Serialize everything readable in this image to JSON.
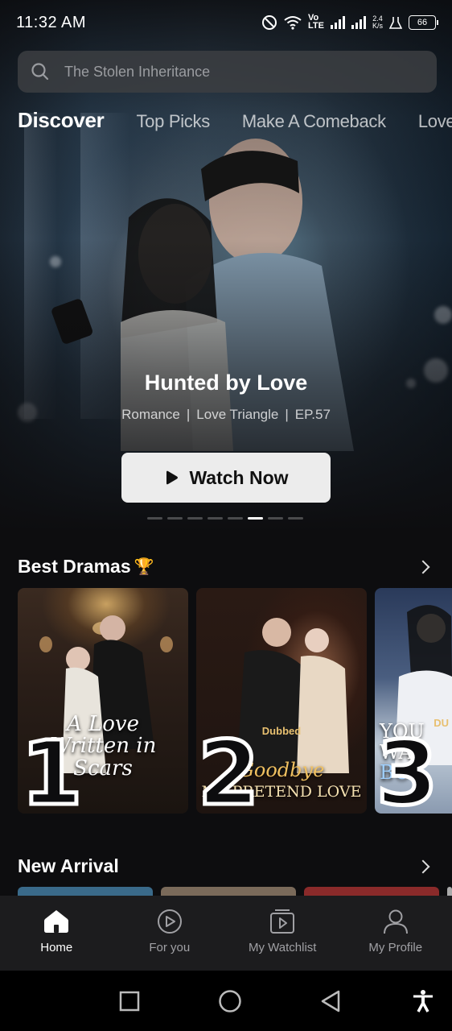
{
  "status_bar": {
    "time": "11:32 AM",
    "network_speed": "2.4",
    "network_unit": "K/s",
    "volte": "Vo",
    "lte": "LTE",
    "battery": "66"
  },
  "search": {
    "placeholder": "The Stolen Inheritance"
  },
  "tabs": [
    {
      "label": "Discover",
      "active": true
    },
    {
      "label": "Top Picks"
    },
    {
      "label": "Make A Comeback"
    },
    {
      "label": "Love"
    }
  ],
  "hero": {
    "title": "Hunted by Love",
    "tags": [
      "Romance",
      "Love Triangle",
      "EP.57"
    ],
    "separator": "|",
    "button_label": "Watch Now",
    "carousel_pages": 8,
    "carousel_active": 6
  },
  "best_dramas": {
    "title": "Best Dramas",
    "trophy": "🏆",
    "items": [
      {
        "rank": "1",
        "title_line1": "A Love",
        "title_line2": "Written in Scars"
      },
      {
        "rank": "2",
        "badge": "Dubbed",
        "title_line1": "Goodbye",
        "title_line2": "MY PRETEND LOVE"
      },
      {
        "rank": "3",
        "badge": "DU",
        "title_line1": "YOU WA",
        "title_line2": "BO"
      }
    ]
  },
  "new_arrival": {
    "title": "New Arrival"
  },
  "bottom_nav": [
    {
      "label": "Home",
      "icon": "home-icon",
      "active": true
    },
    {
      "label": "For you",
      "icon": "play-circle-icon"
    },
    {
      "label": "My Watchlist",
      "icon": "watchlist-icon"
    },
    {
      "label": "My Profile",
      "icon": "profile-icon"
    }
  ],
  "colors": {
    "background": "#0d0d0f",
    "nav_bg": "#1c1c1e",
    "button_bg": "#ececec"
  }
}
